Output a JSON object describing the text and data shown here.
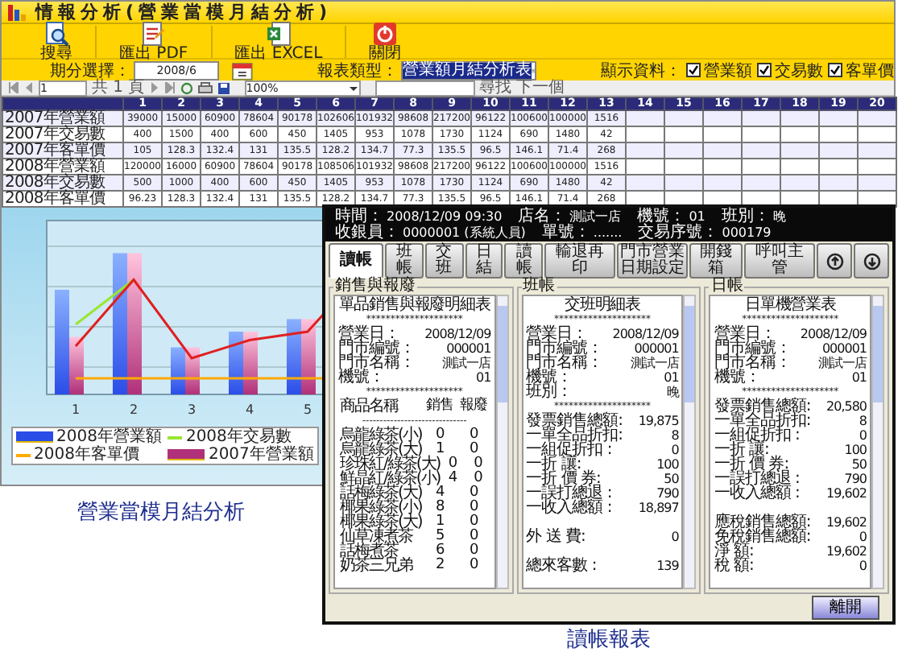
{
  "analysis_window": {
    "title": "情報分析(營業當模月結分析)",
    "toolbar": [
      {
        "kind": "search",
        "label": "搜尋"
      },
      {
        "kind": "pdf",
        "label": "匯出 PDF"
      },
      {
        "kind": "excel",
        "label": "匯出 EXCEL"
      },
      {
        "kind": "close",
        "label": "關閉"
      }
    ],
    "filters": {
      "period_label": "期分選擇：",
      "period_value": "2008/6",
      "report_type_label": "報表類型：",
      "report_type_value": "營業額月結分析表",
      "show_label": "顯示資料：",
      "show_options": [
        {
          "label": "營業額",
          "checked": true
        },
        {
          "label": "交易數",
          "checked": true
        },
        {
          "label": "客單價",
          "checked": true
        }
      ]
    },
    "grid_toolbar": {
      "page": "1",
      "page_count": "共 1 頁",
      "zoom": "100%",
      "find_label": "尋找",
      "next_label": "下一個"
    },
    "table": {
      "columns": [
        "1",
        "2",
        "3",
        "4",
        "5",
        "6",
        "7",
        "8",
        "9",
        "10",
        "11",
        "12",
        "13",
        "14",
        "15",
        "16",
        "17",
        "18",
        "19",
        "20"
      ],
      "rows": [
        {
          "label": "2007年營業額",
          "cells": [
            "39000",
            "15000",
            "60900",
            "78604",
            "90178",
            "102606",
            "101932",
            "98608",
            "217200",
            "96122",
            "100600",
            "100000",
            "1516"
          ]
        },
        {
          "label": "2007年交易數",
          "cells": [
            "400",
            "1500",
            "400",
            "600",
            "450",
            "1405",
            "953",
            "1078",
            "1730",
            "1124",
            "690",
            "1480",
            "42"
          ]
        },
        {
          "label": "2007年客單價",
          "cells": [
            "105",
            "128.3",
            "132.4",
            "131",
            "135.5",
            "128.2",
            "134.7",
            "77.3",
            "135.5",
            "96.5",
            "146.1",
            "71.4",
            "268"
          ]
        },
        {
          "label": "2008年營業額",
          "cells": [
            "120000",
            "16000",
            "60900",
            "78604",
            "90178",
            "108506",
            "101932",
            "98608",
            "217200",
            "96122",
            "100600",
            "100000",
            "1516"
          ]
        },
        {
          "label": "2008年交易數",
          "cells": [
            "500",
            "1000",
            "400",
            "600",
            "450",
            "1405",
            "953",
            "1078",
            "1730",
            "1124",
            "690",
            "1480",
            "42"
          ]
        },
        {
          "label": "2008年客單價",
          "cells": [
            "96.23",
            "128.3",
            "132.4",
            "131",
            "135.5",
            "128.2",
            "134.7",
            "77.3",
            "135.5",
            "96.5",
            "146.1",
            "71.4",
            "268"
          ]
        }
      ]
    },
    "chart": {
      "x_labels": [
        "1",
        "2",
        "3",
        "4",
        "5"
      ],
      "legend": [
        {
          "kind": "bar",
          "label": "2008年營業額",
          "color": "#2a4de8"
        },
        {
          "kind": "line",
          "label": "2008年交易數",
          "color": "#99e633"
        },
        {
          "kind": "line",
          "label": "2008年客單價",
          "color": "#ffaa00"
        },
        {
          "kind": "bar",
          "label": "2007年營業額",
          "color": "#b0307a"
        }
      ]
    }
  },
  "analysis_caption": "營業當模月結分析",
  "report_window": {
    "header": [
      {
        "label": "時間：",
        "value": "2008/12/09 09:30"
      },
      {
        "label": "店名：",
        "value": "測試一店"
      },
      {
        "label": "機號：",
        "value": "01"
      },
      {
        "label": "班別：",
        "value": "晚"
      },
      {
        "label": "收銀員：",
        "value": "0000001 (系統人員)"
      },
      {
        "label": "單號：",
        "value": "......."
      },
      {
        "label": "交易序號：",
        "value": "000179"
      }
    ],
    "tabs": [
      {
        "kind": "text",
        "label": "讀帳",
        "selected": true
      },
      {
        "kind": "text",
        "label": "班帳",
        "selected": false
      },
      {
        "kind": "text",
        "label": "交班",
        "selected": false
      },
      {
        "kind": "text",
        "label": "日結",
        "selected": false
      },
      {
        "kind": "text",
        "label": "讀帳",
        "selected": false
      },
      {
        "kind": "text",
        "label": "輸退再印",
        "selected": false
      },
      {
        "kind": "text",
        "label": "門市營業日期設定",
        "selected": false
      },
      {
        "kind": "text",
        "label": "開錢箱",
        "selected": false
      },
      {
        "kind": "text",
        "label": "呼叫主管",
        "selected": false
      },
      {
        "kind": "up",
        "selected": false
      },
      {
        "kind": "down",
        "selected": false
      }
    ],
    "panels": [
      {
        "title": "銷售與報廢",
        "lines": [
          {
            "kind": "title",
            "text": "單品銷售與報廢明細表"
          },
          {
            "kind": "rule",
            "text": "********************"
          },
          {
            "kind": "pair",
            "label": "營業日：",
            "value": "2008/12/09"
          },
          {
            "kind": "pair",
            "label": "門市編號：",
            "value": "000001"
          },
          {
            "kind": "pair",
            "label": "門市名稱：",
            "value": "測試一店"
          },
          {
            "kind": "pair",
            "label": "機號：",
            "value": "01"
          },
          {
            "kind": "rule",
            "text": "********************"
          },
          {
            "kind": "item",
            "name": "商品名稱",
            "a": "銷售",
            "b": "報廢"
          },
          {
            "kind": "rule",
            "text": "------------------------------"
          },
          {
            "kind": "item",
            "name": "烏龍綠茶(小)",
            "a": "0",
            "b": "0"
          },
          {
            "kind": "item",
            "name": "烏龍綠茶(大)",
            "a": "1",
            "b": "0"
          },
          {
            "kind": "item",
            "name": "珍珠紅/綠茶(大)",
            "a": "0",
            "b": "0"
          },
          {
            "kind": "item",
            "name": "鮮晶紅/綠茶(小)",
            "a": "4",
            "b": "0"
          },
          {
            "kind": "item",
            "name": "話梅綠茶(大)",
            "a": "4",
            "b": "0"
          },
          {
            "kind": "item",
            "name": "椰果綠茶(小)",
            "a": "8",
            "b": "0"
          },
          {
            "kind": "item",
            "name": "椰果綠茶(大)",
            "a": "1",
            "b": "0"
          },
          {
            "kind": "item",
            "name": "仙草凍煮茶",
            "a": "5",
            "b": "0"
          },
          {
            "kind": "item",
            "name": "話梅煮茶",
            "a": "6",
            "b": "0"
          },
          {
            "kind": "item",
            "name": "奶茶三兄弟",
            "a": "2",
            "b": "0"
          }
        ]
      },
      {
        "title": "班帳",
        "lines": [
          {
            "kind": "title",
            "text": "交班明細表"
          },
          {
            "kind": "rule",
            "text": "********************"
          },
          {
            "kind": "pair",
            "label": "營業日：",
            "value": "2008/12/09"
          },
          {
            "kind": "pair",
            "label": "門市編號：",
            "value": "000001"
          },
          {
            "kind": "pair",
            "label": "門市名稱：",
            "value": "測試一店"
          },
          {
            "kind": "pair",
            "label": "機號：",
            "value": "01"
          },
          {
            "kind": "pair",
            "label": "班別：",
            "value": "晚"
          },
          {
            "kind": "rule",
            "text": "********************"
          },
          {
            "kind": "pair",
            "label": "發票銷售總額:",
            "value": "19,875"
          },
          {
            "kind": "pair",
            "label": "一單全品折扣:",
            "value": "8"
          },
          {
            "kind": "pair",
            "label": "一組促折扣 :",
            "value": "0"
          },
          {
            "kind": "pair",
            "label": "一折 讓:",
            "value": "100"
          },
          {
            "kind": "pair",
            "label": "一折 價 券:",
            "value": "50"
          },
          {
            "kind": "pair",
            "label": "一誤打總退 :",
            "value": "790"
          },
          {
            "kind": "pair",
            "label": "一收入總額 :",
            "value": "18,897"
          },
          {
            "kind": "blank"
          },
          {
            "kind": "pair",
            "label": "外 送 費:",
            "value": "0"
          },
          {
            "kind": "blank"
          },
          {
            "kind": "pair",
            "label": "總來客數 :",
            "value": "139"
          }
        ]
      },
      {
        "title": "日帳",
        "lines": [
          {
            "kind": "title",
            "text": "日單機營業表"
          },
          {
            "kind": "rule",
            "text": "********************"
          },
          {
            "kind": "pair",
            "label": "營業日：",
            "value": "2008/12/09"
          },
          {
            "kind": "pair",
            "label": "門市編號：",
            "value": "000001"
          },
          {
            "kind": "pair",
            "label": "門市名稱：",
            "value": "測試一店"
          },
          {
            "kind": "pair",
            "label": "機號：",
            "value": "01"
          },
          {
            "kind": "rule",
            "text": "********************"
          },
          {
            "kind": "pair",
            "label": "發票銷售總額:",
            "value": "20,580"
          },
          {
            "kind": "pair",
            "label": "一單全品折扣:",
            "value": "8"
          },
          {
            "kind": "pair",
            "label": "一組促折扣 :",
            "value": "0"
          },
          {
            "kind": "pair",
            "label": "一折 讓:",
            "value": "100"
          },
          {
            "kind": "pair",
            "label": "一折 價 券:",
            "value": "50"
          },
          {
            "kind": "pair",
            "label": "一誤打總退 :",
            "value": "790"
          },
          {
            "kind": "pair",
            "label": "一收入總額 :",
            "value": "19,602"
          },
          {
            "kind": "blank"
          },
          {
            "kind": "pair",
            "label": "應稅銷售總額:",
            "value": "19,602"
          },
          {
            "kind": "pair",
            "label": "免稅銷售總額:",
            "value": "0"
          },
          {
            "kind": "pair",
            "label": "淨 額:",
            "value": "19,602"
          },
          {
            "kind": "pair",
            "label": "稅 額:",
            "value": "0"
          }
        ]
      }
    ],
    "exit_button": "離開"
  },
  "report_caption": "讀帳報表"
}
